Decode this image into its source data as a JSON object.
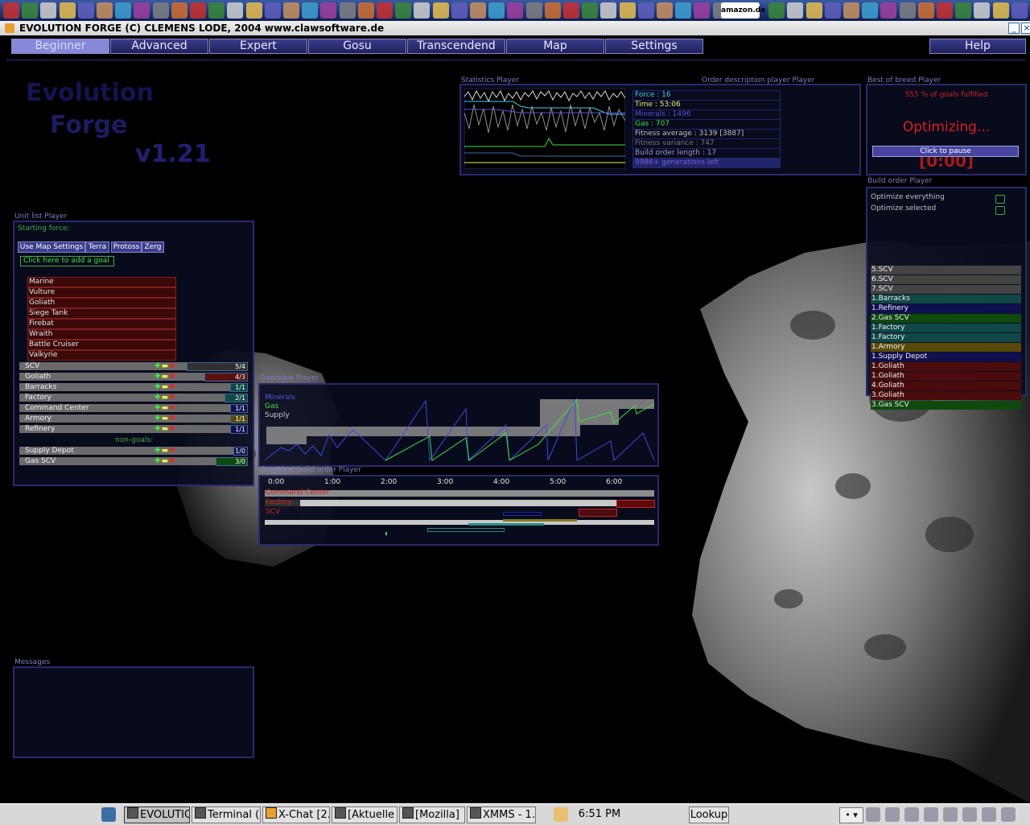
{
  "window": {
    "title": "EVOLUTION FORGE (C) CLEMENS LODE, 2004 www.clawsoftware.de"
  },
  "icon_bar": {
    "amazon_label": "amazon.de"
  },
  "tabs": [
    "Beginner",
    "Advanced",
    "Expert",
    "Gosu",
    "Transcendend",
    "Map",
    "Settings"
  ],
  "help_label": "Help",
  "logo": {
    "line1": "Evolution",
    "line2": "Forge",
    "version": "v1.21"
  },
  "statistics": {
    "title": "Statistics Player",
    "order_title": "Order description player Player",
    "lines": [
      {
        "text": "Force : 16",
        "color": "#44ccee"
      },
      {
        "text": "Time : 53:06",
        "color": "#eeee66"
      },
      {
        "text": "Minerals : 1496",
        "color": "#5555dd"
      },
      {
        "text": "Gas : 707",
        "color": "#44dd44"
      },
      {
        "text": "Fitness average : 3139 [3887]",
        "color": "#c0c0c0"
      },
      {
        "text": "Fitness variance : 747",
        "color": "#777777"
      },
      {
        "text": "Build order length : 17",
        "color": "#9999cc"
      },
      {
        "text": "9986+ generations left",
        "color": "#6666dd"
      }
    ]
  },
  "best_of_breed": {
    "title": "Best of breed Player",
    "goals_text": "555 % of goals fulfilled",
    "status": "Optimizing...",
    "pause_button": "Click to pause",
    "timer": "[0:00]"
  },
  "build_order": {
    "title": "Build order Player",
    "optimize_everything": "Optimize everything",
    "optimize_selected": "Optimize selected",
    "items": [
      {
        "label": "5.SCV",
        "color": "#444444"
      },
      {
        "label": "6.SCV",
        "color": "#444444"
      },
      {
        "label": "7.SCV",
        "color": "#444444"
      },
      {
        "label": "1.Barracks",
        "color": "#104848"
      },
      {
        "label": "1.Refinery",
        "color": "#101050"
      },
      {
        "label": "2.Gas SCV",
        "color": "#0e4a0e"
      },
      {
        "label": "1.Factory",
        "color": "#104848"
      },
      {
        "label": "1.Factory",
        "color": "#104848"
      },
      {
        "label": "1.Armory",
        "color": "#5a4a0a"
      },
      {
        "label": "1.Supply Depot",
        "color": "#101050"
      },
      {
        "label": "1.Goliath",
        "color": "#4a0c0c"
      },
      {
        "label": "1.Goliath",
        "color": "#4a0c0c"
      },
      {
        "label": "4.Goliath",
        "color": "#4a0c0c"
      },
      {
        "label": "3.Goliath",
        "color": "#4a0c0c"
      },
      {
        "label": "3.Gas SCV",
        "color": "#0e4a0e"
      }
    ]
  },
  "unit_list": {
    "title": "Unit list Player",
    "starting_force": "Starting force:",
    "buttons": [
      "Use Map Settings",
      "Terra",
      "Protoss",
      "Zerg"
    ],
    "add_goal": "Click here to add a goal",
    "goal_units": [
      "Marine",
      "Vulture",
      "Goliath",
      "Siege Tank",
      "Firebat",
      "Wraith",
      "Battle Cruiser",
      "Valkyrie"
    ],
    "units": [
      {
        "name": "SCV",
        "count": "5/4",
        "fill": 1.0,
        "color": "#303030"
      },
      {
        "name": "Goliath",
        "count": "4/3",
        "fill": 0.7,
        "color": "#5a1010"
      },
      {
        "name": "Barracks",
        "count": "1/1",
        "fill": 0.25,
        "color": "#104848"
      },
      {
        "name": "Factory",
        "count": "2/1",
        "fill": 0.35,
        "color": "#104848"
      },
      {
        "name": "Command Center",
        "count": "1/1",
        "fill": 0.25,
        "color": "#101050"
      },
      {
        "name": "Armory",
        "count": "1/1",
        "fill": 0.25,
        "color": "#5a4a0a"
      },
      {
        "name": "Refinery",
        "count": "1/1",
        "fill": 0.25,
        "color": "#101050"
      }
    ],
    "non_goals_label": "non-goals:",
    "non_goals": [
      {
        "name": "Supply Depot",
        "count": "1/0",
        "fill": 0.2,
        "color": "#101050"
      },
      {
        "name": "Gas SCV",
        "count": "3/0",
        "fill": 0.5,
        "color": "#0e4a0e"
      }
    ]
  },
  "overview": {
    "title": "Overview Player",
    "legend": [
      {
        "text": "Minerals",
        "color": "#5555dd"
      },
      {
        "text": "Gas",
        "color": "#44dd44"
      },
      {
        "text": "Supply",
        "color": "#c8c8c8"
      }
    ]
  },
  "graphical": {
    "title": "Graphical build order Player",
    "times": [
      "0:00",
      "1:00",
      "2:00",
      "3:00",
      "4:00",
      "5:00",
      "6:00"
    ],
    "rows": [
      {
        "label": "Command Center",
        "color": "#cc2222"
      },
      {
        "label": "Factory",
        "color": "#cc2222"
      },
      {
        "label": "SCV",
        "color": "#cc2222"
      }
    ]
  },
  "messages": {
    "title": "Messages"
  },
  "taskbar": {
    "tasks": [
      "EVOLUTIO",
      "Terminal (i",
      "X-Chat [2.0",
      "[Aktuelle N",
      "[Mozilla]",
      "XMMS - 1."
    ],
    "clock": "6:51 PM",
    "lookup": "Lookup"
  }
}
